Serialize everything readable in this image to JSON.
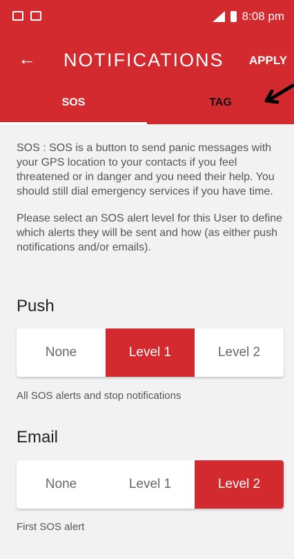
{
  "status_bar": {
    "time": "8:08 pm"
  },
  "app_bar": {
    "title": "NOTIFICATIONS",
    "apply_label": "APPLY"
  },
  "tabs": [
    {
      "label": "SOS",
      "selected": true
    },
    {
      "label": "TAG",
      "selected": false
    }
  ],
  "description": {
    "para1": "SOS : SOS is a button to send panic messages with your GPS location to your contacts if you feel threatened or in danger and you need their help. You should still dial emergency services if you have time.",
    "para2": "Please select an SOS alert level for this User to define which alerts they will be sent and how (as either push notifications and/or emails)."
  },
  "push": {
    "title": "Push",
    "options": [
      "None",
      "Level 1",
      "Level 2"
    ],
    "selected": "Level 1",
    "caption": "All SOS alerts and stop notifications"
  },
  "email": {
    "title": "Email",
    "options": [
      "None",
      "Level 1",
      "Level 2"
    ],
    "selected": "Level 2",
    "caption": "First SOS alert"
  },
  "colors": {
    "accent": "#d22a2e",
    "background": "#f2f2f2"
  }
}
